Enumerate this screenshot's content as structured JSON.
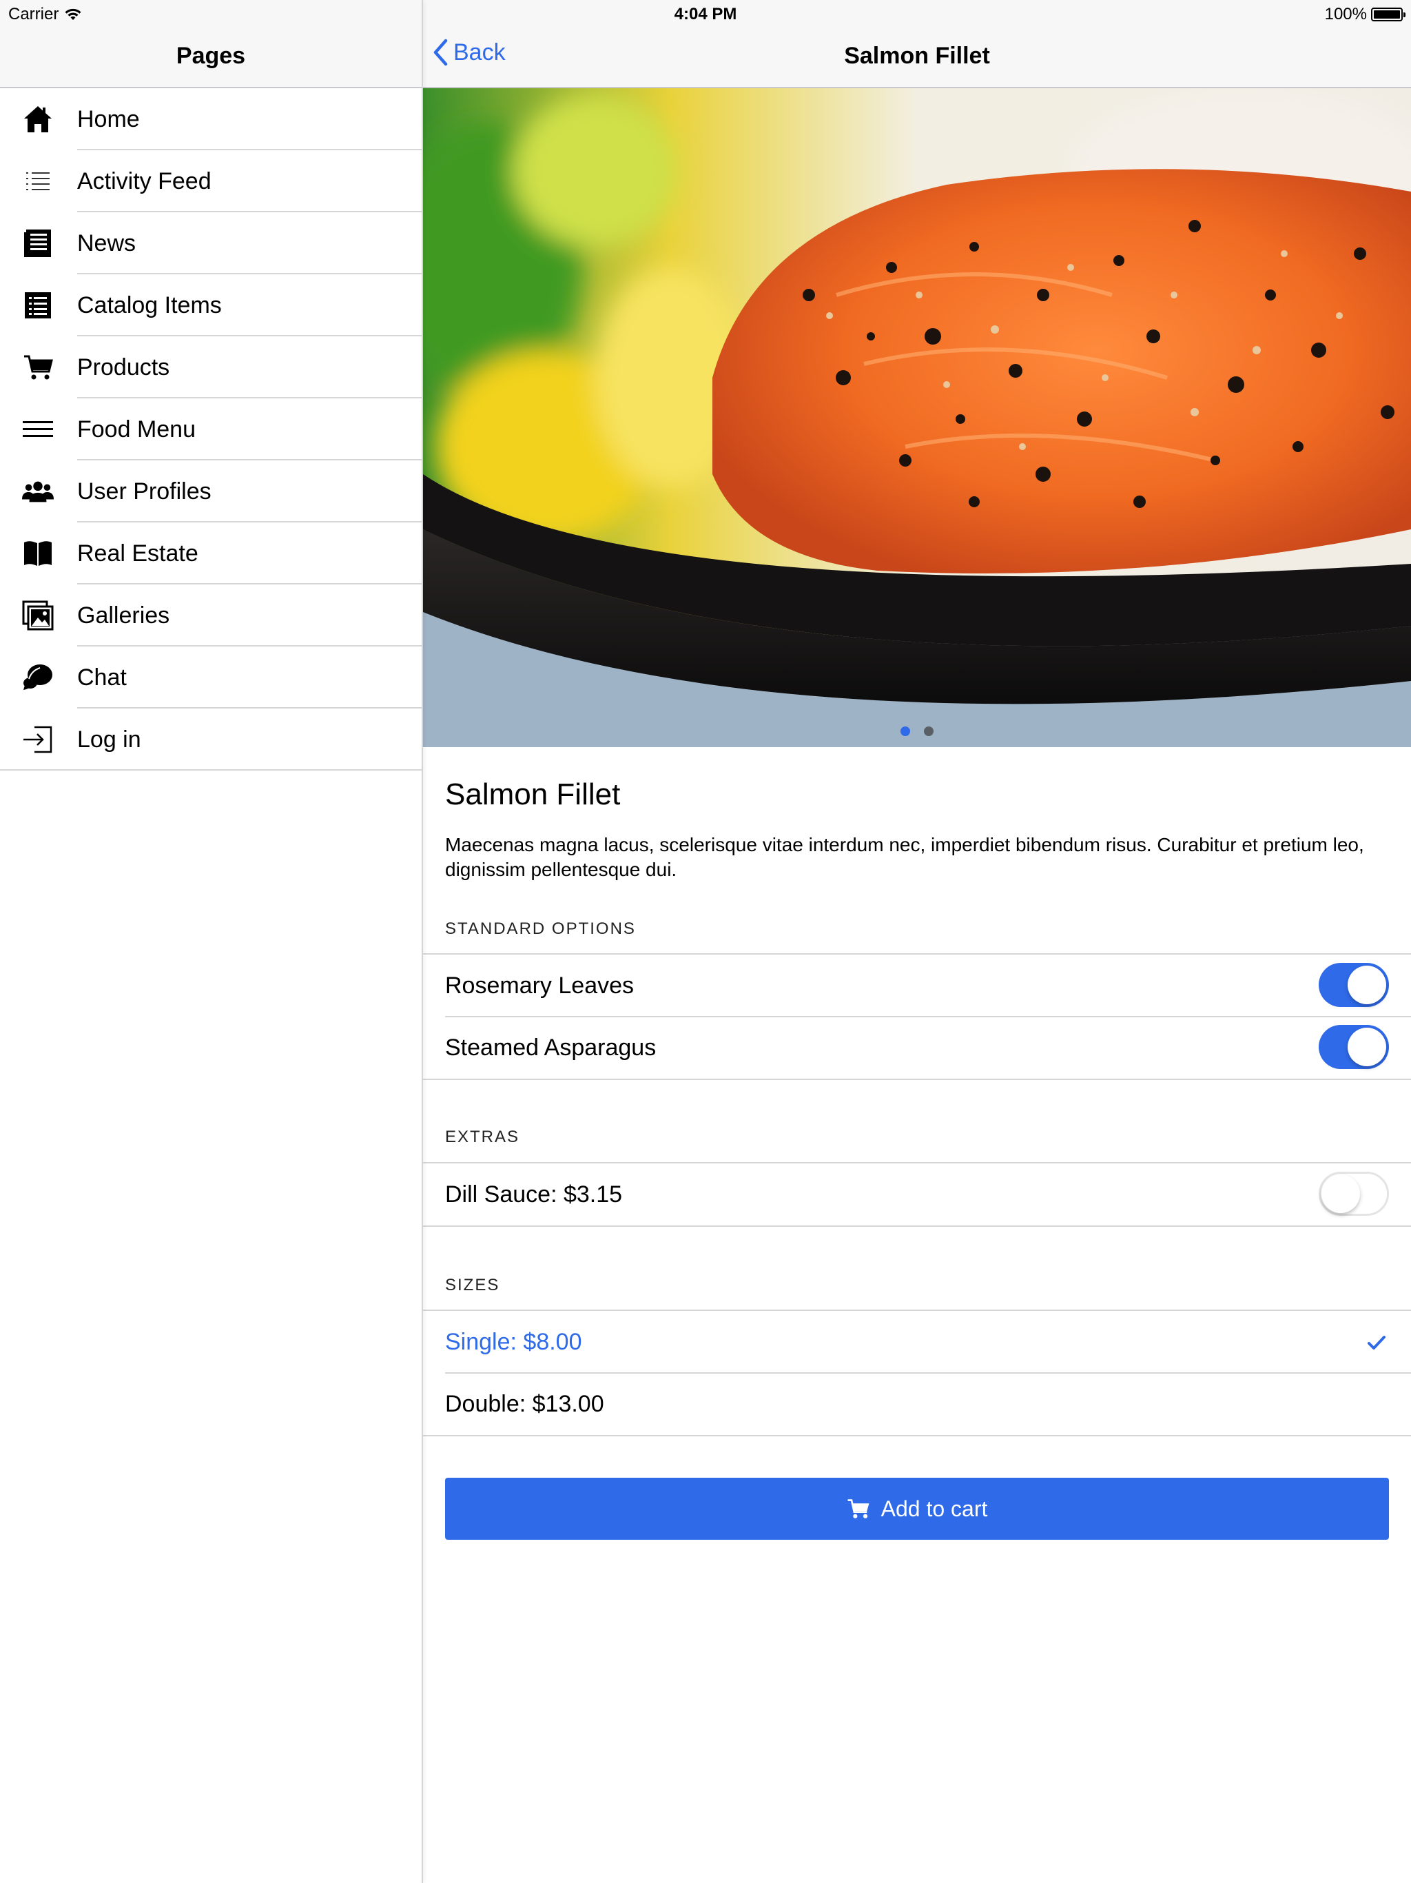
{
  "status_bar": {
    "carrier": "Carrier",
    "time": "4:04 PM",
    "battery": "100%"
  },
  "sidebar": {
    "title": "Pages",
    "items": [
      {
        "label": "Home",
        "icon": "home-icon"
      },
      {
        "label": "Activity Feed",
        "icon": "list-icon"
      },
      {
        "label": "News",
        "icon": "newspaper-icon"
      },
      {
        "label": "Catalog Items",
        "icon": "catalog-icon"
      },
      {
        "label": "Products",
        "icon": "cart-icon"
      },
      {
        "label": "Food Menu",
        "icon": "hamburger-menu-icon"
      },
      {
        "label": "User Profiles",
        "icon": "users-icon"
      },
      {
        "label": "Real Estate",
        "icon": "book-icon"
      },
      {
        "label": "Galleries",
        "icon": "gallery-icon"
      },
      {
        "label": "Chat",
        "icon": "chat-icon"
      },
      {
        "label": "Log in",
        "icon": "login-icon"
      }
    ]
  },
  "navbar": {
    "back_label": "Back",
    "title": "Salmon Fillet"
  },
  "product": {
    "title": "Salmon Fillet",
    "description": "Maecenas magna lacus, scelerisque vitae interdum nec, imperdiet bibendum risus. Curabitur et pretium leo, dignissim pellentesque dui.",
    "image_pages": 2,
    "image_current_page": 1
  },
  "sections": {
    "standard": {
      "header": "STANDARD OPTIONS",
      "options": [
        {
          "label": "Rosemary Leaves",
          "on": true
        },
        {
          "label": "Steamed Asparagus",
          "on": true
        }
      ]
    },
    "extras": {
      "header": "EXTRAS",
      "options": [
        {
          "label": "Dill Sauce: $3.15",
          "on": false
        }
      ]
    },
    "sizes": {
      "header": "SIZES",
      "options": [
        {
          "label": "Single: $8.00",
          "selected": true
        },
        {
          "label": "Double: $13.00",
          "selected": false
        }
      ]
    }
  },
  "cart_button": {
    "label": "Add to cart",
    "icon": "cart-icon"
  },
  "colors": {
    "accent": "#2f6ae8",
    "separator": "#d6d6d8",
    "bar_background": "#f7f7f7"
  }
}
